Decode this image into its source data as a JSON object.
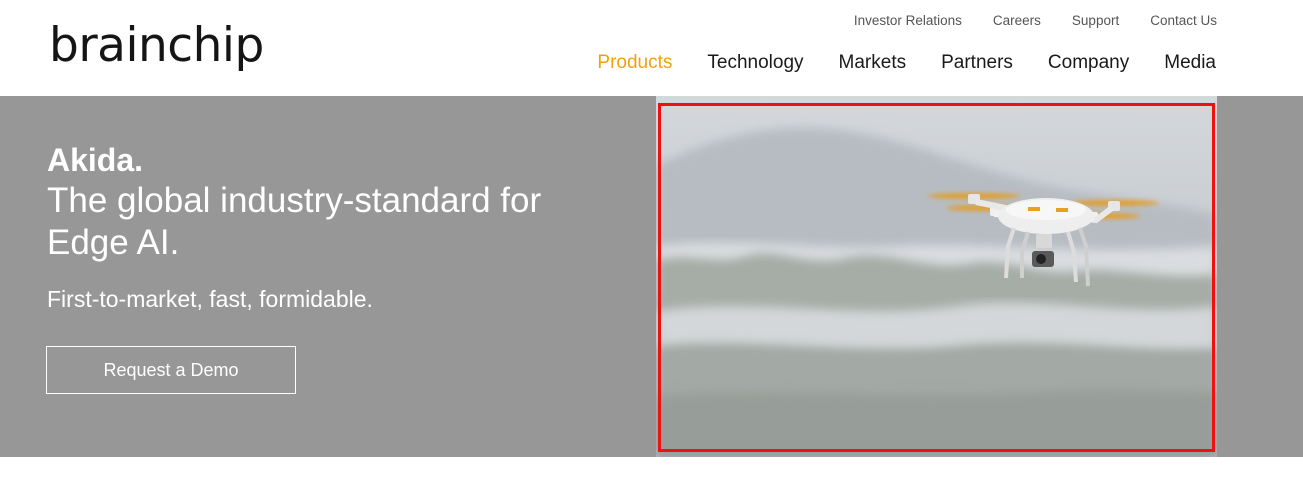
{
  "header": {
    "logo_text": "brainchip",
    "utility_nav": [
      {
        "label": "Investor Relations"
      },
      {
        "label": "Careers"
      },
      {
        "label": "Support"
      },
      {
        "label": "Contact Us"
      }
    ],
    "main_nav": [
      {
        "label": "Products",
        "active": true
      },
      {
        "label": "Technology",
        "active": false
      },
      {
        "label": "Markets",
        "active": false
      },
      {
        "label": "Partners",
        "active": false
      },
      {
        "label": "Company",
        "active": false
      },
      {
        "label": "Media",
        "active": false
      }
    ]
  },
  "hero": {
    "heading": "Akida.",
    "tagline": "The global industry-standard for Edge AI.",
    "subheading": "First-to-market, fast, formidable.",
    "cta_label": "Request a Demo",
    "image_subject": "drone-over-misty-hills"
  },
  "colors": {
    "accent": "#f1a10d",
    "hero_background": "#979797",
    "highlight_frame": "#ee1111",
    "text_dark": "#1a1a1a"
  }
}
